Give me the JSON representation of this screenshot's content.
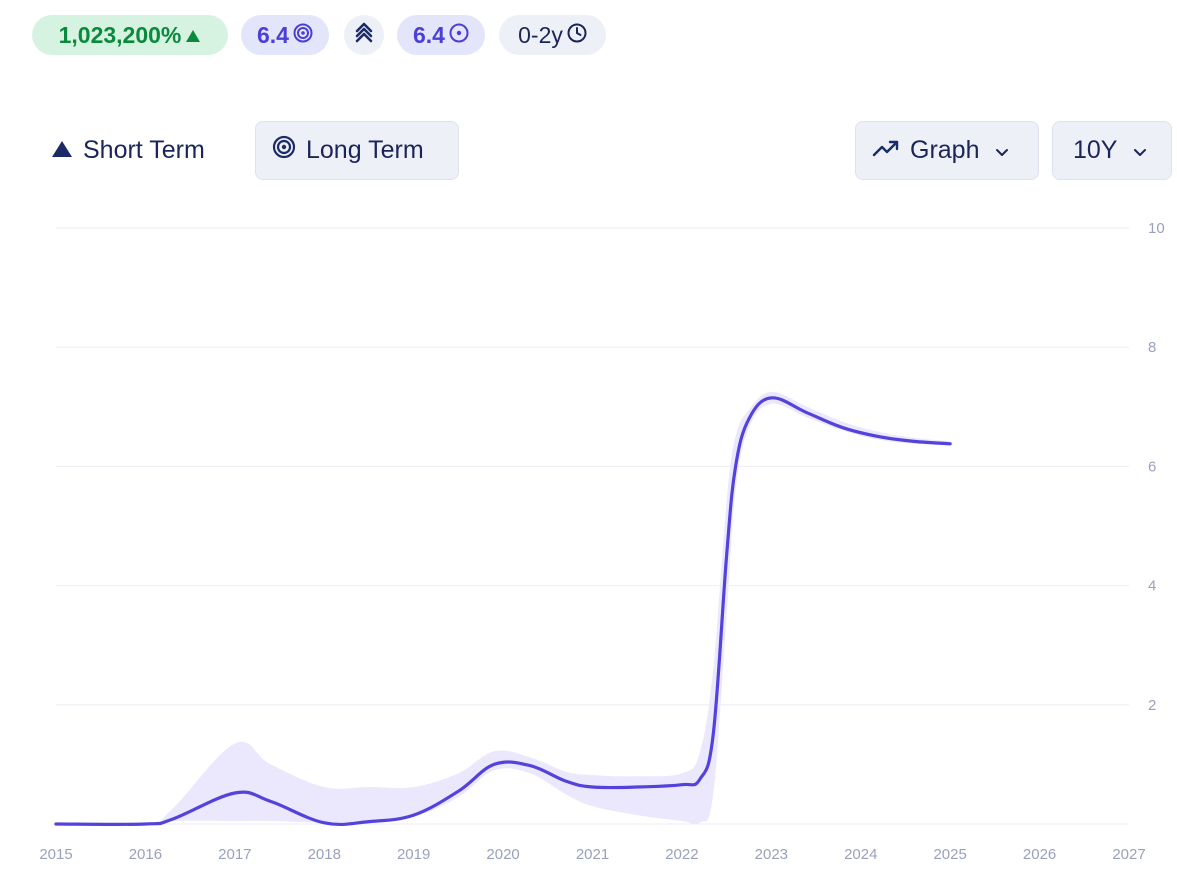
{
  "badges": {
    "growth": "1,023,200%",
    "score": "6.4",
    "score_secondary": "6.4",
    "horizon": "0-2y"
  },
  "icons": {
    "growth": "triangle-up-icon",
    "score": "target-icon",
    "speed": "double-chevron-up-icon",
    "score_secondary": "circle-dot-icon",
    "horizon": "clock-icon"
  },
  "colors": {
    "growth_text": "#0b8a3e",
    "growth_bg": "#d6f3e2",
    "score_text": "#4b3fd6",
    "score_bg": "#e3e5fb",
    "line": "#5342dc",
    "band": "#ebe8fd",
    "text_dark": "#1b2559",
    "axis_text": "#9aa1bd"
  },
  "toggles": {
    "short_term": "Short Term",
    "long_term": "Long Term",
    "selected": "long_term"
  },
  "controls": {
    "view_label": "Graph",
    "range_label": "10Y"
  },
  "chart_data": {
    "type": "line",
    "x": [
      2015,
      2016,
      2016.3,
      2017,
      2017.4,
      2018,
      2018.5,
      2019,
      2019.5,
      2019.9,
      2020.3,
      2020.7,
      2021,
      2021.5,
      2022,
      2022.2,
      2022.35,
      2022.5,
      2022.6,
      2022.75,
      2023,
      2023.4,
      2023.8,
      2024.2,
      2024.6,
      2025
    ],
    "series": [
      {
        "values": [
          0,
          0,
          0.08,
          0.52,
          0.38,
          0.02,
          0.04,
          0.15,
          0.55,
          1.0,
          0.98,
          0.72,
          0.62,
          0.62,
          0.66,
          0.75,
          1.5,
          4.5,
          6.0,
          6.8,
          7.15,
          6.9,
          6.65,
          6.5,
          6.42,
          6.38
        ],
        "lower": [
          0,
          0,
          0.05,
          0.05,
          0.05,
          0.02,
          0.04,
          0.12,
          0.45,
          0.9,
          0.85,
          0.5,
          0.3,
          0.15,
          0.05,
          0.02,
          0.5,
          3.5,
          5.6,
          6.65,
          7.05,
          6.82,
          6.6,
          6.45,
          6.38,
          6.35
        ],
        "upper": [
          0,
          0,
          0.25,
          1.35,
          1.0,
          0.62,
          0.62,
          0.62,
          0.85,
          1.22,
          1.12,
          0.88,
          0.82,
          0.8,
          0.85,
          1.2,
          2.6,
          5.4,
          6.5,
          6.95,
          7.25,
          7.0,
          6.75,
          6.58,
          6.48,
          6.42
        ]
      }
    ],
    "xticks": [
      "2015",
      "2016",
      "2017",
      "2018",
      "2019",
      "2020",
      "2021",
      "2022",
      "2023",
      "2024",
      "2025",
      "2026",
      "2027"
    ],
    "yticks": [
      "2",
      "4",
      "6",
      "8",
      "10"
    ],
    "xlim": [
      2015,
      2027
    ],
    "ylim": [
      0,
      10
    ],
    "grid": true,
    "y_axis_side": "right",
    "xlabel": "",
    "ylabel": ""
  }
}
